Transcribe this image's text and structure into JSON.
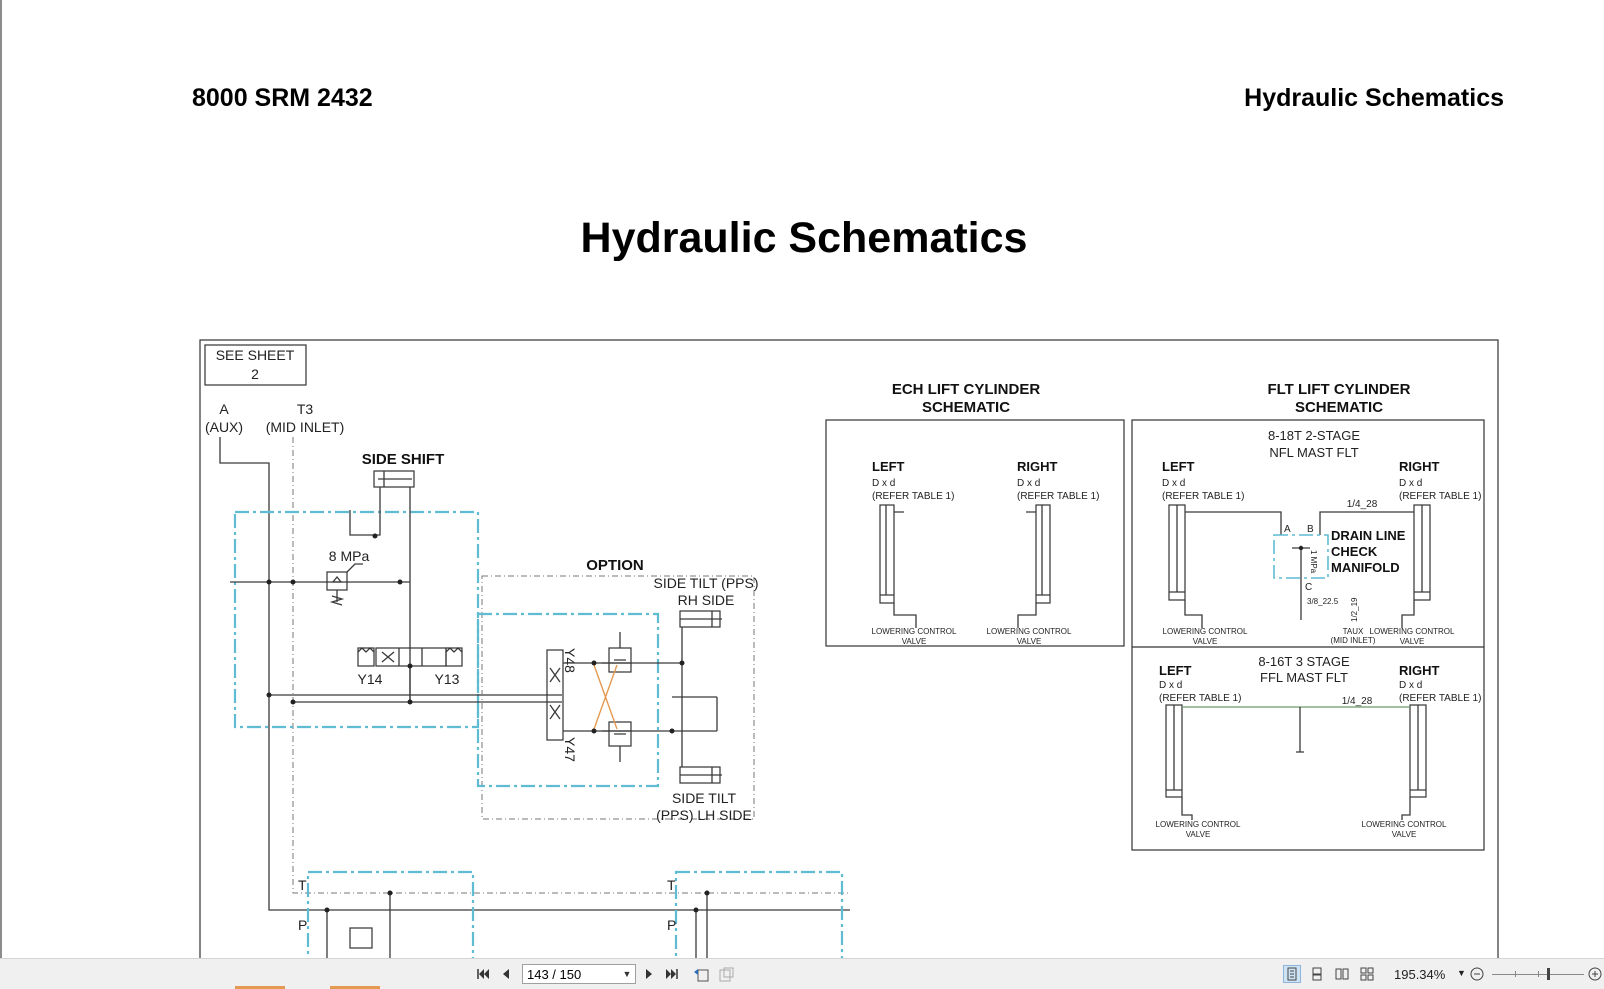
{
  "document": {
    "header_left": "8000 SRM 2432",
    "header_right": "Hydraulic Schematics",
    "title": "Hydraulic Schematics"
  },
  "schematic": {
    "see_sheet": [
      "SEE SHEET",
      "2"
    ],
    "port_a": [
      "A",
      "(AUX)"
    ],
    "port_t3": [
      "T3",
      "(MID INLET)"
    ],
    "side_shift": "SIDE SHIFT",
    "relief_pressure": "8 MPa",
    "solenoid_y14": "Y14",
    "solenoid_y13": "Y13",
    "option": "OPTION",
    "side_tilt_rh": [
      "SIDE TILT (PPS)",
      "RH SIDE"
    ],
    "side_tilt_lh": [
      "SIDE TILT",
      "(PPS) LH SIDE"
    ],
    "solenoid_y48": "Y48",
    "solenoid_y47": "Y47",
    "port_t": "T",
    "port_p": "P",
    "ech_title": [
      "ECH LIFT CYLINDER",
      "SCHEMATIC"
    ],
    "flt_title": [
      "FLT LIFT CYLINDER",
      "SCHEMATIC"
    ],
    "left": "LEFT",
    "right": "RIGHT",
    "dxd": "D x d",
    "refer_table": "(REFER TABLE 1)",
    "lowering_valve": [
      "LOWERING CONTROL",
      "VALVE"
    ],
    "nfl_mast": [
      "8-18T 2-STAGE",
      "NFL MAST FLT"
    ],
    "ffl_mast": [
      "8-16T 3 STAGE",
      "FFL MAST FLT"
    ],
    "drain_manifold": [
      "DRAIN LINE",
      "CHECK",
      "MANIFOLD"
    ],
    "pipe_quarter": "1/4_28",
    "pipe_3_8": "3/8_22.5",
    "pipe_half": "1/2_19",
    "taux": [
      "TAUX",
      "(MID INLET)"
    ],
    "manifold_port_a": "A",
    "manifold_port_b": "B",
    "manifold_port_c": "C",
    "manifold_pressure": "1 MPa"
  },
  "toolbar": {
    "page_value": "143 / 150",
    "zoom": "195.34%",
    "icons": [
      "first-page-icon",
      "previous-page-icon",
      "next-page-icon",
      "last-page-icon",
      "previous-view-icon",
      "next-view-icon",
      "single-page-icon",
      "continuous-icon",
      "facing-icon",
      "continuous-facing-icon",
      "zoom-out-icon",
      "zoom-in-icon"
    ]
  },
  "colors": {
    "accent_teal": "#5fbcd3",
    "accent_orange": "#e59a52",
    "line_gray": "#4a4a4a"
  }
}
